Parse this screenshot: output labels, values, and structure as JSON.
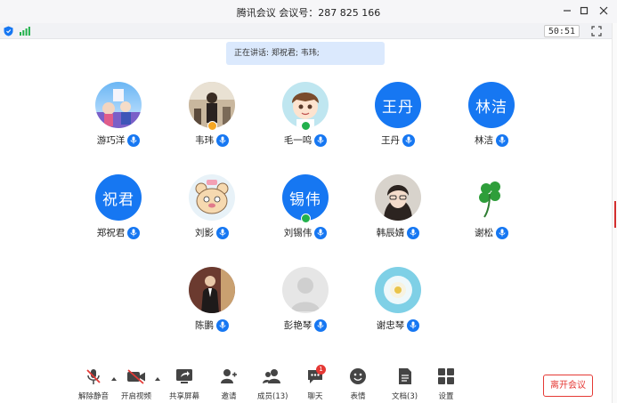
{
  "window": {
    "app_name": "腾讯会议",
    "meeting_label": "会议号：",
    "meeting_id": "287 825 166"
  },
  "status": {
    "timer": "50:51"
  },
  "speaking": {
    "prefix": "正在讲话: ",
    "names": "郑祝君; 韦玮;"
  },
  "participants": [
    {
      "name": "游巧洋",
      "avatar": "photo-anime-scene"
    },
    {
      "name": "韦玮",
      "avatar": "photo-person-indoors",
      "badge": "host-badge"
    },
    {
      "name": "毛一鸣",
      "avatar": "photo-cartoon-boy",
      "badge": "cohost-badge"
    },
    {
      "name": "王丹",
      "avatar_text": "王丹"
    },
    {
      "name": "林洁",
      "avatar_text": "林洁"
    },
    {
      "name": "郑祝君",
      "avatar_text": "祝君"
    },
    {
      "name": "刘影",
      "avatar": "photo-cartoon-bear"
    },
    {
      "name": "刘锡伟",
      "avatar_text": "锡伟",
      "badge": "cohost-badge"
    },
    {
      "name": "韩辰婧",
      "avatar": "photo-girl-portrait"
    },
    {
      "name": "谢松",
      "avatar": "photo-four-leaf-clover"
    },
    {
      "name": "陈鹏",
      "avatar": "photo-man-in-suit"
    },
    {
      "name": "彭艳琴",
      "avatar": "default-person-icon"
    },
    {
      "name": "谢忠琴",
      "avatar": "photo-flower"
    }
  ],
  "toolbar": {
    "mute": "解除静音",
    "video": "开启视频",
    "share": "共享屏幕",
    "invite": "邀请",
    "members": "成员(13)",
    "chat": "聊天",
    "chat_unread": "1",
    "reaction": "表情",
    "docs": "文档(3)",
    "settings": "设置",
    "leave": "离开会议"
  },
  "colors": {
    "accent": "#1677f2",
    "leave": "#e53935",
    "speaking_bg": "#dbe9fd"
  }
}
